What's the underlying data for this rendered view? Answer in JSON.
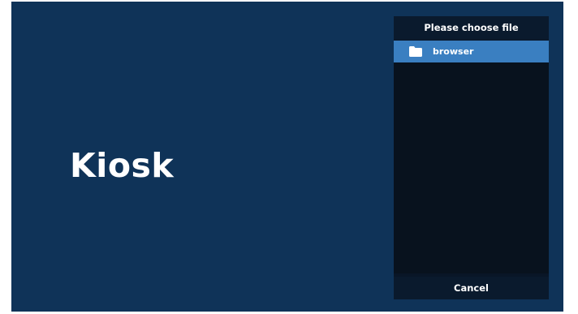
{
  "app": {
    "title": "Kiosk"
  },
  "file_dialog": {
    "title": "Please choose file",
    "items": [
      {
        "label": "browser",
        "icon": "folder-icon",
        "selected": true
      }
    ],
    "cancel_label": "Cancel"
  },
  "colors": {
    "screen_background": "#0f3358",
    "dialog_background": "#091627",
    "selected_item": "#3a7fc1",
    "text": "#ffffff"
  }
}
